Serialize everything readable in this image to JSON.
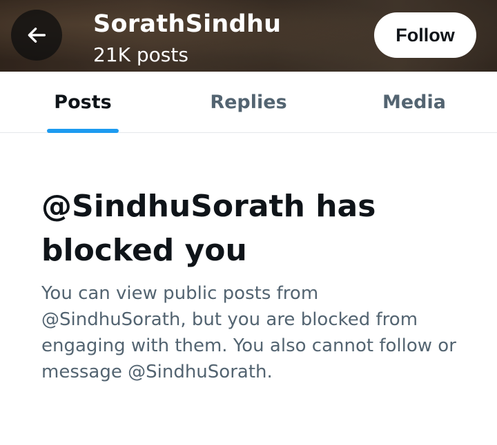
{
  "header": {
    "back_icon": "arrow-left-icon",
    "profile_name": "SorathSindhu",
    "post_count": "21K posts",
    "follow_label": "Follow"
  },
  "tabs": [
    {
      "label": "Posts",
      "active": true
    },
    {
      "label": "Replies",
      "active": false
    },
    {
      "label": "Media",
      "active": false
    }
  ],
  "blocked": {
    "title": "@SindhuSorath has blocked you",
    "description": "You can view public posts from @SindhuSorath, but you are blocked from engaging with them. You also cannot follow or message @SindhuSorath."
  },
  "colors": {
    "accent": "#1d9bf0",
    "text_primary": "#0f1419",
    "text_secondary": "#536471"
  }
}
